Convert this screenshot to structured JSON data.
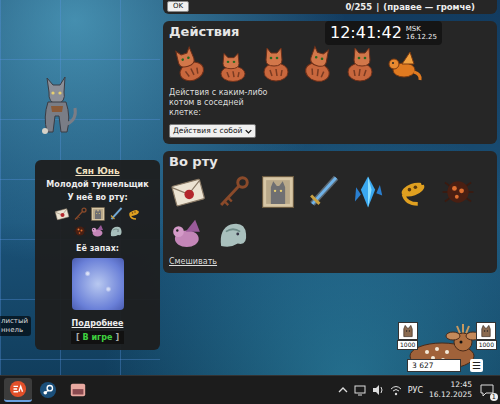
{
  "top_bar": {
    "button": "OK",
    "counter": "0/255",
    "separator": "|",
    "hint": "(правее — громче)"
  },
  "clock": {
    "time": "12:41:42",
    "zone": "MSK",
    "date": "16.12.25"
  },
  "actions_panel": {
    "title": "Действия",
    "actions": [
      {
        "kind": "cat-sniff"
      },
      {
        "kind": "cat-lie"
      },
      {
        "kind": "cat-sit"
      },
      {
        "kind": "cat-dig"
      },
      {
        "kind": "cat-attack"
      },
      {
        "kind": "creature"
      }
    ],
    "description": "Действия с каким-либо котом в соседней клетке:",
    "select": "Действия с собой"
  },
  "mouth_panel": {
    "title": "Во рту",
    "items": [
      {
        "kind": "letter"
      },
      {
        "kind": "key"
      },
      {
        "kind": "portrait"
      },
      {
        "kind": "sword"
      },
      {
        "kind": "crystal"
      },
      {
        "kind": "lizard"
      },
      {
        "kind": "bug"
      },
      {
        "kind": "dragon"
      },
      {
        "kind": "ghost"
      }
    ],
    "mix_link": "Смешивать"
  },
  "cat_card": {
    "name": "Сян Юнь",
    "rank": "Молодой туннельщик",
    "mouth_label": "У неё во рту:",
    "mouth_items": [
      {
        "kind": "letter"
      },
      {
        "kind": "key"
      },
      {
        "kind": "portrait"
      },
      {
        "kind": "sword"
      },
      {
        "kind": "lizard"
      },
      {
        "kind": "bug"
      },
      {
        "kind": "dragon"
      },
      {
        "kind": "ghost"
      }
    ],
    "smell_label": "Её запах:",
    "more_link": "Подробнее",
    "status_open": "[",
    "status": "В игре",
    "status_close": "]"
  },
  "map_label": {
    "lines": [
      "листый",
      "ннель"
    ]
  },
  "counter_widget": {
    "badges": [
      "1000",
      "1000"
    ],
    "value": "3 627",
    "menu": "☰"
  },
  "taskbar": {
    "apps": [
      {
        "kind": "ea",
        "selected": true
      },
      {
        "kind": "steam",
        "selected": false
      },
      {
        "kind": "game",
        "selected": false
      }
    ],
    "language": "РУС",
    "time": "12:45",
    "date": "16.12.2025",
    "notifications": "1"
  }
}
